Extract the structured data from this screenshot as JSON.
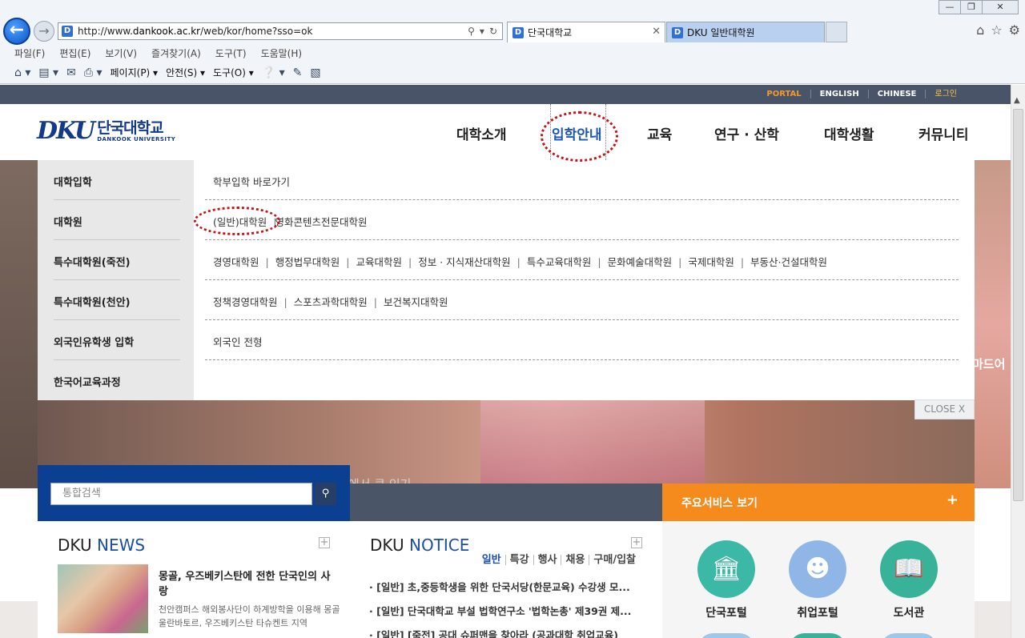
{
  "browser": {
    "url_prefix": "http://www.",
    "url_domain": "dankook.ac.kr",
    "url_path": "/web/kor/home?sso=ok",
    "tabs": [
      {
        "label": "단국대학교"
      },
      {
        "label": "DKU 일반대학원"
      }
    ],
    "menu": [
      "파일(F)",
      "편집(E)",
      "보기(V)",
      "즐겨찾기(A)",
      "도구(T)",
      "도움말(H)"
    ],
    "commands": {
      "page": "페이지(P) ▾",
      "safety": "안전(S) ▾",
      "tools": "도구(O) ▾"
    }
  },
  "util_links": {
    "portal": "PORTAL",
    "english": "ENGLISH",
    "chinese": "CHINESE",
    "login": "로그인"
  },
  "logo": {
    "mark": "DKU",
    "ko": "단국대학교",
    "en": "DANKOOK UNIVERSITY"
  },
  "gnb": [
    "대학소개",
    "입학안내",
    "교육",
    "연구 · 산학",
    "대학생활",
    "커뮤니티"
  ],
  "mega_menu": {
    "categories": [
      "대학입학",
      "대학원",
      "특수대학원(죽전)",
      "특수대학원(천안)",
      "외국인유학생 입학",
      "한국어교육과정"
    ],
    "row1": [
      "학부입학 바로가기"
    ],
    "row2": [
      "(일반)대학원",
      "영화콘텐츠전문대학원"
    ],
    "row3": [
      "경영대학원",
      "행정법무대학원",
      "교육대학원",
      "정보 · 지식재산대학원",
      "특수교육대학원",
      "문화예술대학원",
      "국제대학원",
      "부동산·건설대학원"
    ],
    "row4": [
      "정책경영대학원",
      "스포츠과학대학원",
      "보건복지대학원"
    ],
    "row5": [
      "외국인 전형"
    ],
    "close": "CLOSE X"
  },
  "hero": {
    "caption": "우리 대학 학생들과 교류하며 한국문화 배울 수 있어 세계 전역에서 큰 인기",
    "side_text": "마드어"
  },
  "search": {
    "placeholder": "통합검색"
  },
  "news": {
    "title_prefix": "DKU",
    "title_suffix": "NEWS",
    "headline": "몽골, 우즈베키스탄에 전한 단국인의 사랑",
    "desc": "천안캠퍼스 해외봉사단이 하계방학을 이용해 몽골 울란바토르, 우즈베키스탄 타슈켄트 지역"
  },
  "notice": {
    "title_prefix": "DKU",
    "title_suffix": "NOTICE",
    "tabs": [
      "일반",
      "특강",
      "행사",
      "채용",
      "구매/입찰"
    ],
    "items": [
      "· [일반] 초,중등학생을 위한 단국서당(한문교육) 수강생 모...",
      "· [일반] 단국대학교 부설 법학연구소 '법학논총' 제39권 제...",
      "· [일반] [죽전] 공대 슈퍼맨을 찾아라 (공과대학 취업교육)"
    ]
  },
  "services": {
    "title": "주요서비스 보기",
    "plus": "+",
    "items": [
      {
        "label": "단국포털",
        "color": "#3cb8a6"
      },
      {
        "label": "취업포털",
        "color": "#8fb6e6"
      },
      {
        "label": "도서관",
        "color": "#38b39a"
      }
    ]
  }
}
